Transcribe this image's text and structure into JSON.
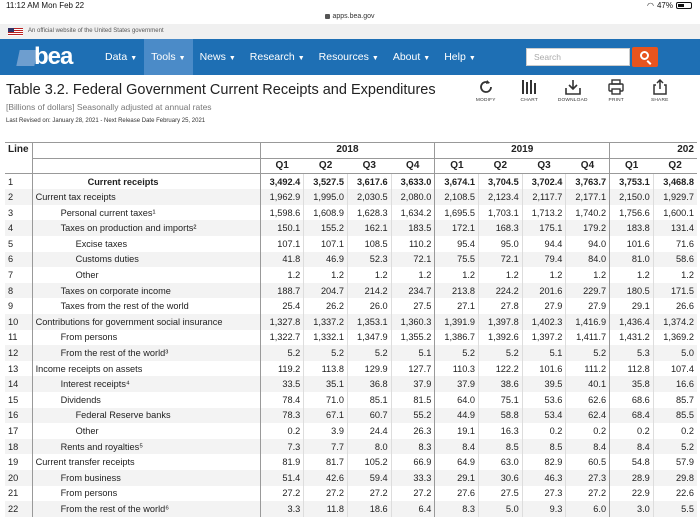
{
  "status": {
    "time": "11:12 AM  Mon Feb 22",
    "battery": "47%"
  },
  "url": "apps.bea.gov",
  "gov_banner": "An official website of the United States government",
  "nav": {
    "logo": "bea",
    "items": [
      {
        "label": "Data"
      },
      {
        "label": "Tools"
      },
      {
        "label": "News"
      },
      {
        "label": "Research"
      },
      {
        "label": "Resources"
      },
      {
        "label": "About"
      },
      {
        "label": "Help"
      }
    ],
    "search_placeholder": "Search"
  },
  "page": {
    "title": "Table 3.2. Federal Government Current Receipts and Expenditures",
    "subtitle": "[Billions of dollars] Seasonally adjusted at annual rates",
    "revised": "Last Revised on: January 28, 2021 - Next Release Date February 25, 2021"
  },
  "toolbar": [
    {
      "label": "MODIFY",
      "icon": "refresh-icon"
    },
    {
      "label": "CHART",
      "icon": "chart-icon"
    },
    {
      "label": "DOWNLOAD",
      "icon": "download-icon"
    },
    {
      "label": "PRINT",
      "icon": "print-icon"
    },
    {
      "label": "SHARE",
      "icon": "share-icon"
    }
  ],
  "table": {
    "line_header": "Line",
    "years": [
      "2018",
      "2019",
      "202"
    ],
    "quarters": [
      "Q1",
      "Q2",
      "Q3",
      "Q4",
      "Q1",
      "Q2",
      "Q3",
      "Q4",
      "Q1",
      "Q2"
    ],
    "rows": [
      {
        "line": "1",
        "label": "Current receipts",
        "indent": 3,
        "bold": true,
        "values": [
          "3,492.4",
          "3,527.5",
          "3,617.6",
          "3,633.0",
          "3,674.1",
          "3,704.5",
          "3,702.4",
          "3,763.7",
          "3,753.1",
          "3,468.8"
        ]
      },
      {
        "line": "2",
        "label": "Current tax receipts",
        "indent": 0,
        "values": [
          "1,962.9",
          "1,995.0",
          "2,030.5",
          "2,080.0",
          "2,108.5",
          "2,123.4",
          "2,117.7",
          "2,177.1",
          "2,150.0",
          "1,929.7"
        ]
      },
      {
        "line": "3",
        "label": "Personal current taxes¹",
        "indent": 1,
        "values": [
          "1,598.6",
          "1,608.9",
          "1,628.3",
          "1,634.2",
          "1,695.5",
          "1,703.1",
          "1,713.2",
          "1,740.2",
          "1,756.6",
          "1,600.1"
        ]
      },
      {
        "line": "4",
        "label": "Taxes on production and imports²",
        "indent": 1,
        "values": [
          "150.1",
          "155.2",
          "162.1",
          "183.5",
          "172.1",
          "168.3",
          "175.1",
          "179.2",
          "183.8",
          "131.4"
        ]
      },
      {
        "line": "5",
        "label": "Excise taxes",
        "indent": 2,
        "values": [
          "107.1",
          "107.1",
          "108.5",
          "110.2",
          "95.4",
          "95.0",
          "94.4",
          "94.0",
          "101.6",
          "71.6"
        ]
      },
      {
        "line": "6",
        "label": "Customs duties",
        "indent": 2,
        "values": [
          "41.8",
          "46.9",
          "52.3",
          "72.1",
          "75.5",
          "72.1",
          "79.4",
          "84.0",
          "81.0",
          "58.6"
        ]
      },
      {
        "line": "7",
        "label": "Other",
        "indent": 2,
        "values": [
          "1.2",
          "1.2",
          "1.2",
          "1.2",
          "1.2",
          "1.2",
          "1.2",
          "1.2",
          "1.2",
          "1.2"
        ]
      },
      {
        "line": "8",
        "label": "Taxes on corporate income",
        "indent": 1,
        "values": [
          "188.7",
          "204.7",
          "214.2",
          "234.7",
          "213.8",
          "224.2",
          "201.6",
          "229.7",
          "180.5",
          "171.5"
        ]
      },
      {
        "line": "9",
        "label": "Taxes from the rest of the world",
        "indent": 1,
        "values": [
          "25.4",
          "26.2",
          "26.0",
          "27.5",
          "27.1",
          "27.8",
          "27.9",
          "27.9",
          "29.1",
          "26.6"
        ]
      },
      {
        "line": "10",
        "label": "Contributions for government social insurance",
        "indent": 0,
        "values": [
          "1,327.8",
          "1,337.2",
          "1,353.1",
          "1,360.3",
          "1,391.9",
          "1,397.8",
          "1,402.3",
          "1,416.9",
          "1,436.4",
          "1,374.2"
        ]
      },
      {
        "line": "11",
        "label": "From persons",
        "indent": 1,
        "values": [
          "1,322.7",
          "1,332.1",
          "1,347.9",
          "1,355.2",
          "1,386.7",
          "1,392.6",
          "1,397.2",
          "1,411.7",
          "1,431.2",
          "1,369.2"
        ]
      },
      {
        "line": "12",
        "label": "From the rest of the world³",
        "indent": 1,
        "values": [
          "5.2",
          "5.2",
          "5.2",
          "5.1",
          "5.2",
          "5.2",
          "5.1",
          "5.2",
          "5.3",
          "5.0"
        ]
      },
      {
        "line": "13",
        "label": "Income receipts on assets",
        "indent": 0,
        "values": [
          "119.2",
          "113.8",
          "129.9",
          "127.7",
          "110.3",
          "122.2",
          "101.6",
          "111.2",
          "112.8",
          "107.4"
        ]
      },
      {
        "line": "14",
        "label": "Interest receipts⁴",
        "indent": 1,
        "values": [
          "33.5",
          "35.1",
          "36.8",
          "37.9",
          "37.9",
          "38.6",
          "39.5",
          "40.1",
          "35.8",
          "16.6"
        ]
      },
      {
        "line": "15",
        "label": "Dividends",
        "indent": 1,
        "values": [
          "78.4",
          "71.0",
          "85.1",
          "81.5",
          "64.0",
          "75.1",
          "53.6",
          "62.6",
          "68.6",
          "85.7"
        ]
      },
      {
        "line": "16",
        "label": "Federal Reserve banks",
        "indent": 2,
        "values": [
          "78.3",
          "67.1",
          "60.7",
          "55.2",
          "44.9",
          "58.8",
          "53.4",
          "62.4",
          "68.4",
          "85.5"
        ]
      },
      {
        "line": "17",
        "label": "Other",
        "indent": 2,
        "values": [
          "0.2",
          "3.9",
          "24.4",
          "26.3",
          "19.1",
          "16.3",
          "0.2",
          "0.2",
          "0.2",
          "0.2"
        ]
      },
      {
        "line": "18",
        "label": "Rents and royalties⁵",
        "indent": 1,
        "values": [
          "7.3",
          "7.7",
          "8.0",
          "8.3",
          "8.4",
          "8.5",
          "8.5",
          "8.4",
          "8.4",
          "5.2"
        ]
      },
      {
        "line": "19",
        "label": "Current transfer receipts",
        "indent": 0,
        "values": [
          "81.9",
          "81.7",
          "105.2",
          "66.9",
          "64.9",
          "63.0",
          "82.9",
          "60.5",
          "54.8",
          "57.9"
        ]
      },
      {
        "line": "20",
        "label": "From business",
        "indent": 1,
        "values": [
          "51.4",
          "42.6",
          "59.4",
          "33.3",
          "29.1",
          "30.6",
          "46.3",
          "27.3",
          "28.9",
          "29.8"
        ]
      },
      {
        "line": "21",
        "label": "From persons",
        "indent": 1,
        "values": [
          "27.2",
          "27.2",
          "27.2",
          "27.2",
          "27.6",
          "27.5",
          "27.3",
          "27.2",
          "22.9",
          "22.6"
        ]
      },
      {
        "line": "22",
        "label": "From the rest of the world⁶",
        "indent": 1,
        "values": [
          "3.3",
          "11.8",
          "18.6",
          "6.4",
          "8.3",
          "5.0",
          "9.3",
          "6.0",
          "3.0",
          "5.5"
        ]
      }
    ]
  }
}
